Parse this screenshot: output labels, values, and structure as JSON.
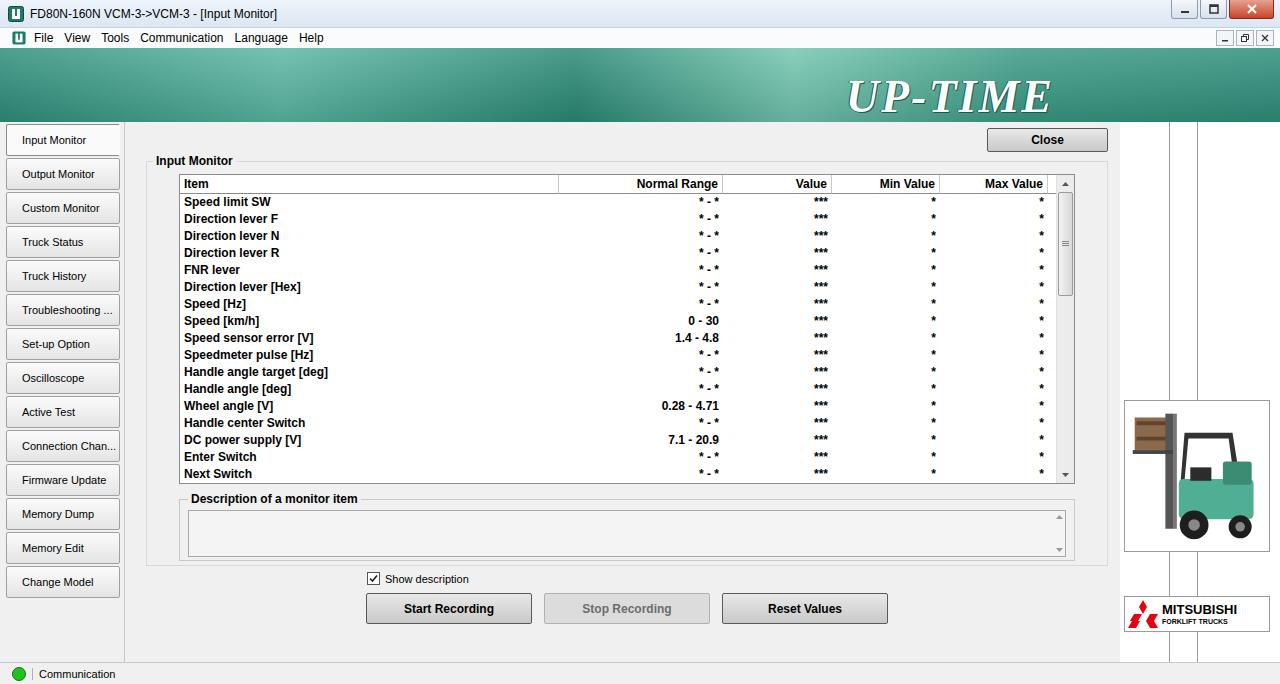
{
  "window": {
    "title": "FD80N-160N VCM-3->VCM-3 - [Input Monitor]"
  },
  "menu": [
    "File",
    "View",
    "Tools",
    "Communication",
    "Language",
    "Help"
  ],
  "banner": {
    "logo_text": "UP-TIME"
  },
  "sidebar": {
    "items": [
      {
        "label": "Input Monitor",
        "selected": true
      },
      {
        "label": "Output Monitor",
        "selected": false
      },
      {
        "label": "Custom Monitor",
        "selected": false
      },
      {
        "label": "Truck Status",
        "selected": false
      },
      {
        "label": "Truck History",
        "selected": false
      },
      {
        "label": "Troubleshooting ...",
        "selected": false
      },
      {
        "label": "Set-up Option",
        "selected": false
      },
      {
        "label": "Oscilloscope",
        "selected": false
      },
      {
        "label": "Active Test",
        "selected": false
      },
      {
        "label": "Connection Chan...",
        "selected": false
      },
      {
        "label": "Firmware Update",
        "selected": false
      },
      {
        "label": "Memory Dump",
        "selected": false
      },
      {
        "label": "Memory Edit",
        "selected": false
      },
      {
        "label": "Change Model",
        "selected": false
      }
    ]
  },
  "close_button": "Close",
  "monitor": {
    "title": "Input Monitor",
    "columns": [
      "Item",
      "Normal Range",
      "Value",
      "Min Value",
      "Max Value"
    ],
    "rows": [
      {
        "item": "Speed limit SW",
        "range": "* - *",
        "value": "***",
        "min": "*",
        "max": "*"
      },
      {
        "item": "Direction lever F",
        "range": "* - *",
        "value": "***",
        "min": "*",
        "max": "*"
      },
      {
        "item": "Direction lever N",
        "range": "* - *",
        "value": "***",
        "min": "*",
        "max": "*"
      },
      {
        "item": "Direction lever R",
        "range": "* - *",
        "value": "***",
        "min": "*",
        "max": "*"
      },
      {
        "item": "FNR lever",
        "range": "* - *",
        "value": "***",
        "min": "*",
        "max": "*"
      },
      {
        "item": "Direction lever [Hex]",
        "range": "* - *",
        "value": "***",
        "min": "*",
        "max": "*"
      },
      {
        "item": "Speed [Hz]",
        "range": "* - *",
        "value": "***",
        "min": "*",
        "max": "*"
      },
      {
        "item": "Speed [km/h]",
        "range": "0 - 30",
        "value": "***",
        "min": "*",
        "max": "*"
      },
      {
        "item": "Speed sensor error [V]",
        "range": "1.4 - 4.8",
        "value": "***",
        "min": "*",
        "max": "*"
      },
      {
        "item": "Speedmeter pulse [Hz]",
        "range": "* - *",
        "value": "***",
        "min": "*",
        "max": "*"
      },
      {
        "item": "Handle angle target [deg]",
        "range": "* - *",
        "value": "***",
        "min": "*",
        "max": "*"
      },
      {
        "item": "Handle angle [deg]",
        "range": "* - *",
        "value": "***",
        "min": "*",
        "max": "*"
      },
      {
        "item": "Wheel angle [V]",
        "range": "0.28 - 4.71",
        "value": "***",
        "min": "*",
        "max": "*"
      },
      {
        "item": "Handle center Switch",
        "range": "* - *",
        "value": "***",
        "min": "*",
        "max": "*"
      },
      {
        "item": "DC power supply [V]",
        "range": "7.1 - 20.9",
        "value": "***",
        "min": "*",
        "max": "*"
      },
      {
        "item": "Enter Switch",
        "range": "* - *",
        "value": "***",
        "min": "*",
        "max": "*"
      },
      {
        "item": "Next Switch",
        "range": "* - *",
        "value": "***",
        "min": "*",
        "max": "*"
      }
    ],
    "scroll_share": 0.38
  },
  "description": {
    "title": "Description of a monitor item",
    "text": ""
  },
  "show_description": {
    "label": "Show description",
    "checked": true
  },
  "buttons": [
    {
      "label": "Start Recording",
      "disabled": false
    },
    {
      "label": "Stop Recording",
      "disabled": true
    },
    {
      "label": "Reset Values",
      "disabled": false
    }
  ],
  "brand": {
    "name": "MITSUBISHI",
    "subtitle": "FORKLIFT TRUCKS"
  },
  "status_bar": {
    "text": "Communication",
    "connected": true,
    "color": "#1fc21f"
  }
}
